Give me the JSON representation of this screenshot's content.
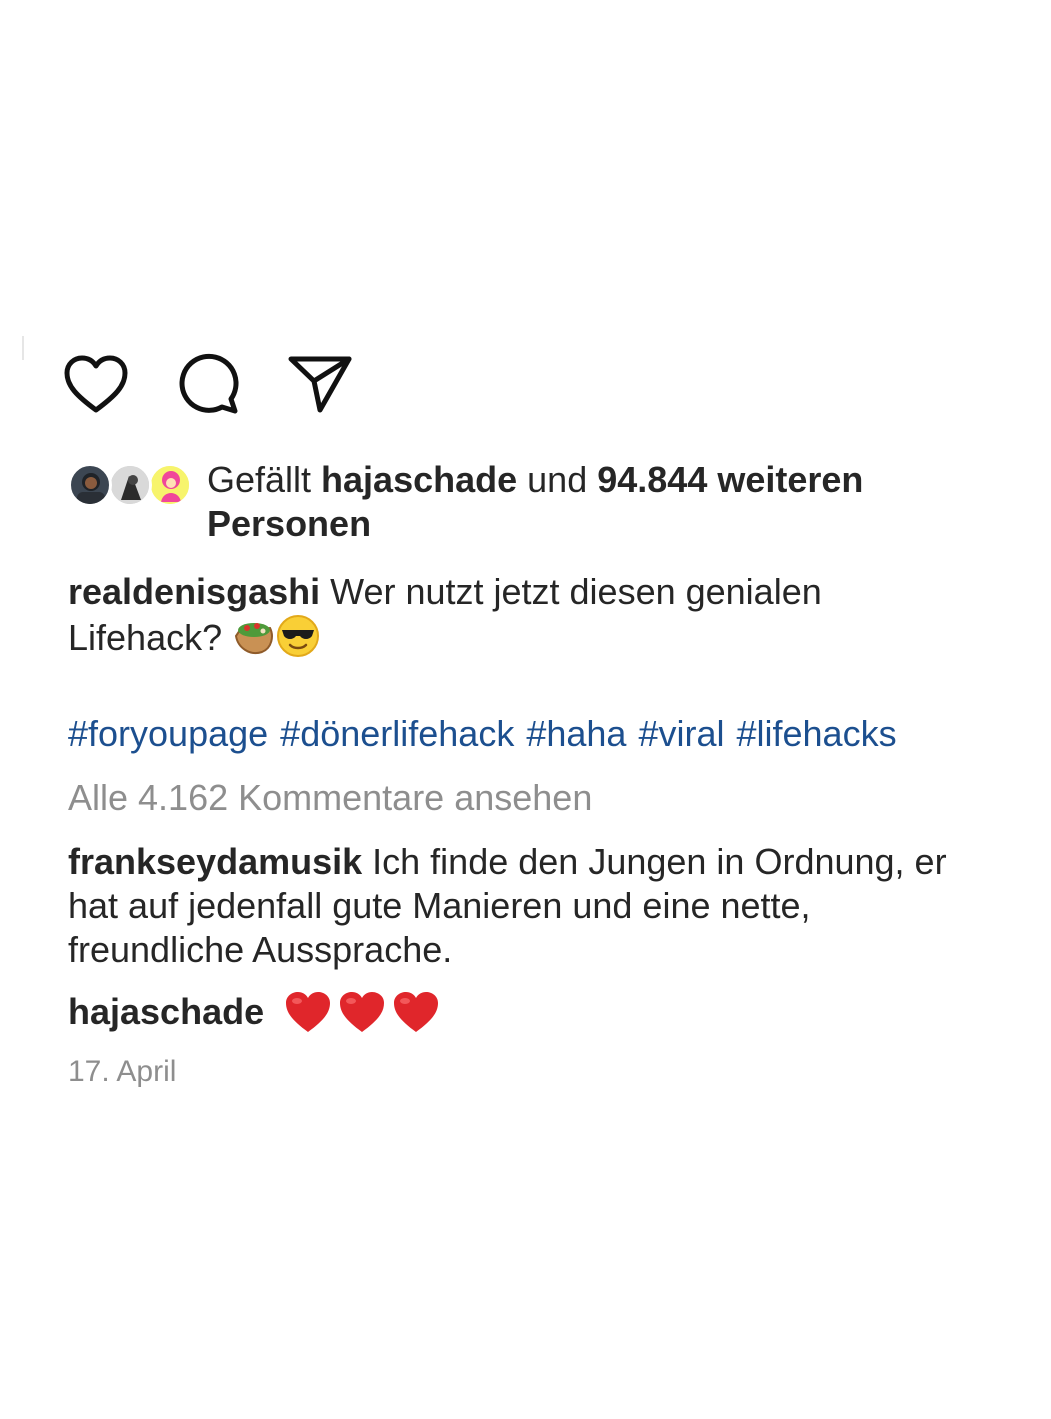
{
  "actions": {
    "like_icon": "heart-outline-icon",
    "comment_icon": "comment-bubble-icon",
    "share_icon": "paper-plane-icon"
  },
  "likes": {
    "prefix": "Gefällt ",
    "user": "hajaschade",
    "middle": " und ",
    "count_text": "94.844 weiteren Personen"
  },
  "caption": {
    "username": "realdenisgashi",
    "text": " Wer nutzt jetzt diesen genialen Lifehack?",
    "emojis": [
      "kebab-emoji",
      "sunglasses-emoji"
    ]
  },
  "hashtags": [
    "#foryoupage",
    "#dönerlifehack",
    "#haha",
    "#viral",
    "#lifehacks"
  ],
  "view_all_comments": "Alle 4.162 Kommentare ansehen",
  "comments": [
    {
      "username": "frankseydamusik",
      "text": " Ich finde den Jungen in Ordnung, er hat auf jedenfall gute Manieren und eine nette, freundliche Aussprache."
    },
    {
      "username": "hajaschade",
      "text": "",
      "emojis": [
        "red-heart-emoji",
        "red-heart-emoji",
        "red-heart-emoji"
      ]
    }
  ],
  "date": "17. April",
  "colors": {
    "text": "#262626",
    "hashtag": "#1c4f8f",
    "muted": "#8e8e8e",
    "heart": "#e0262b"
  }
}
